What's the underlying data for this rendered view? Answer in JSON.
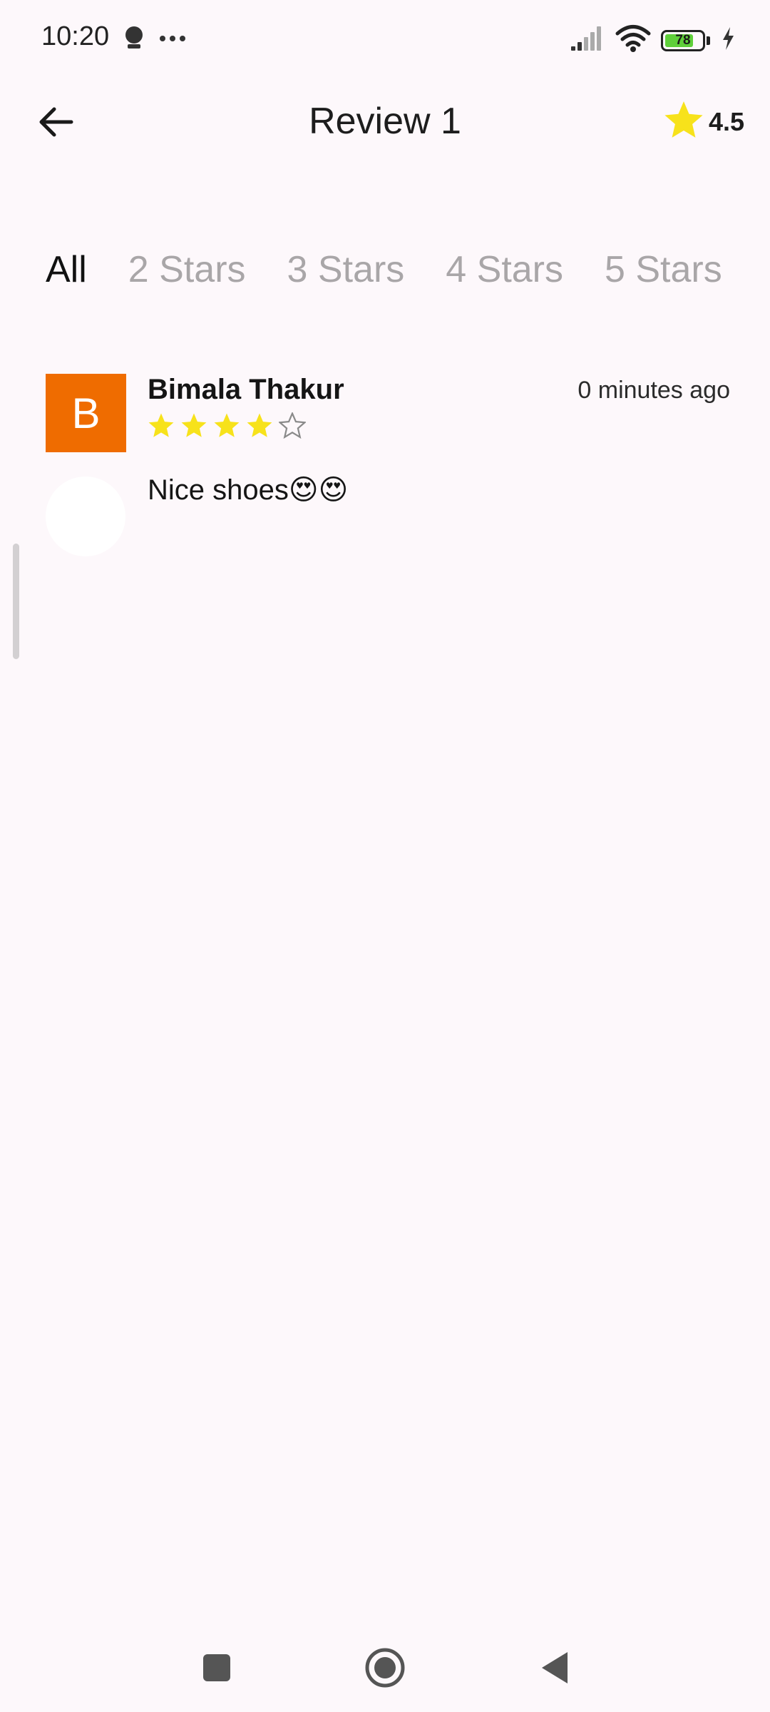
{
  "status_bar": {
    "time": "10:20",
    "battery_level": "78",
    "battery_fraction": 0.78
  },
  "header": {
    "title": "Review 1",
    "rating": "4.5"
  },
  "tabs": [
    {
      "label": "All",
      "active": true
    },
    {
      "label": "2 Stars",
      "active": false
    },
    {
      "label": "3 Stars",
      "active": false
    },
    {
      "label": "4 Stars",
      "active": false
    },
    {
      "label": "5 Stars",
      "active": false
    }
  ],
  "review": {
    "avatar_letter": "B",
    "avatar_color": "#ef6c00",
    "name": "Bimala Thakur",
    "time": "0 minutes ago",
    "stars": 4,
    "max_stars": 5,
    "text": "Nice shoes😍😍"
  },
  "colors": {
    "star": "#f7e21b",
    "accent": "#ef6c00"
  },
  "icons": {
    "back": "arrow-left-icon",
    "rating": "star-icon",
    "nav_recents": "square-icon",
    "nav_home": "circle-icon",
    "nav_back": "triangle-back-icon"
  }
}
